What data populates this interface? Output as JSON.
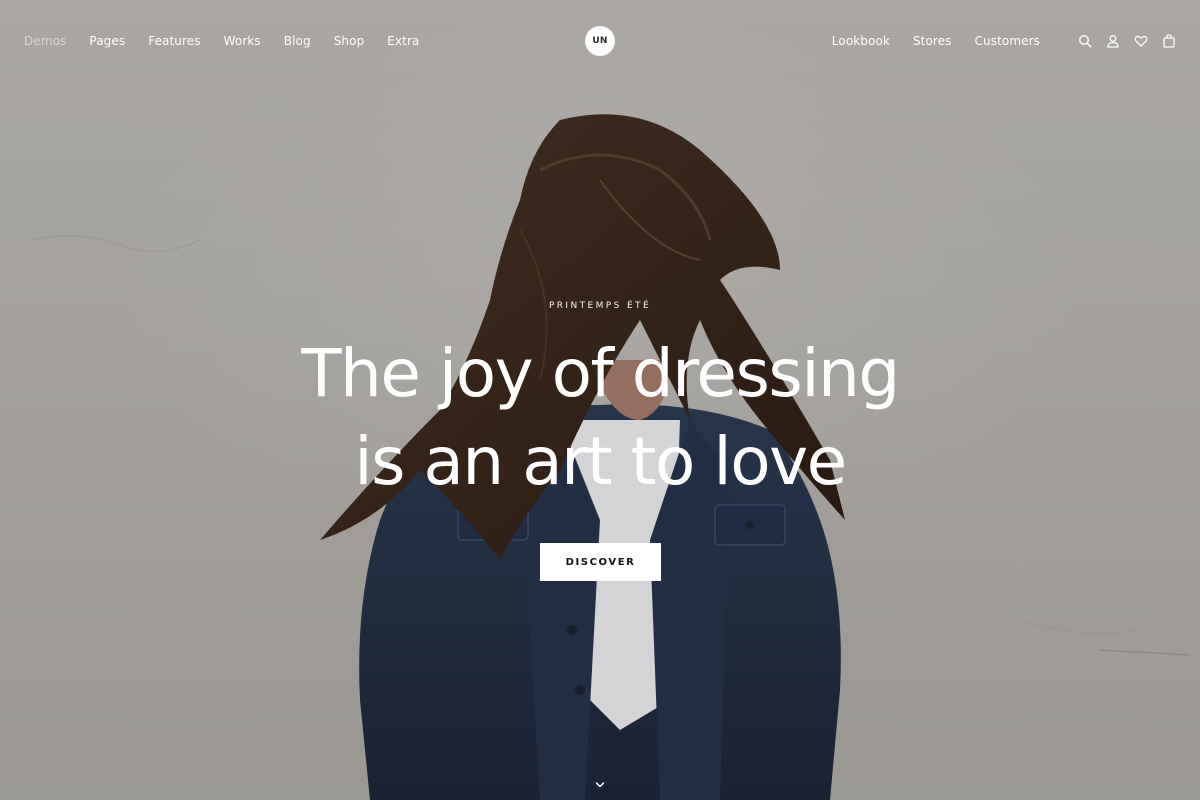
{
  "nav": {
    "left": [
      {
        "label": "Demos",
        "active": true
      },
      {
        "label": "Pages"
      },
      {
        "label": "Features"
      },
      {
        "label": "Works"
      },
      {
        "label": "Blog"
      },
      {
        "label": "Shop"
      },
      {
        "label": "Extra"
      }
    ],
    "right": [
      {
        "label": "Lookbook"
      },
      {
        "label": "Stores"
      },
      {
        "label": "Customers"
      }
    ],
    "icons": [
      "search-icon",
      "user-icon",
      "heart-icon",
      "bag-icon"
    ]
  },
  "logo": {
    "text": "UN"
  },
  "hero": {
    "kicker": "PRINTEMPS ÉTÉ",
    "headline_line1": "The joy of dressing",
    "headline_line2": "is an art to love",
    "cta": "DISCOVER"
  },
  "colors": {
    "background": "#b2afaa",
    "text": "#ffffff",
    "button_bg": "#ffffff",
    "button_text": "#111111"
  }
}
